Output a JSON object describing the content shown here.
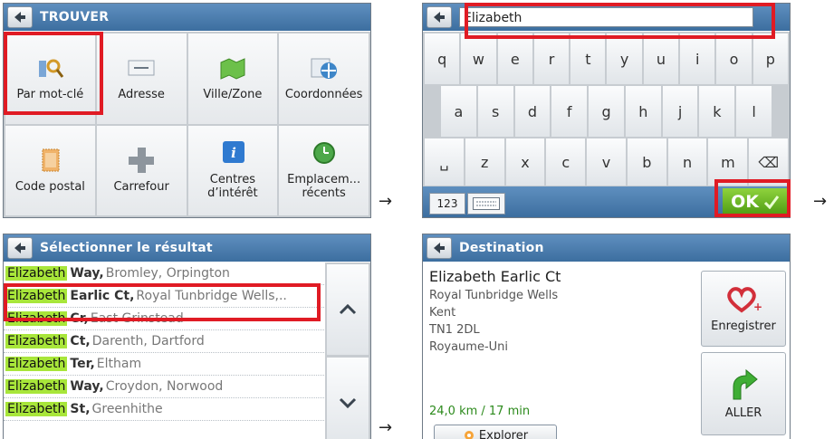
{
  "panels": {
    "trouver": {
      "title": "TROUVER",
      "tiles": [
        {
          "label": "Par mot-clé",
          "icon": "keyword-search-icon"
        },
        {
          "label": "Adresse",
          "icon": "address-card-icon"
        },
        {
          "label": "Ville/Zone",
          "icon": "map-region-icon"
        },
        {
          "label": "Coordonnées",
          "icon": "globe-coordinates-icon"
        },
        {
          "label": "Code postal",
          "icon": "postage-stamp-icon"
        },
        {
          "label": "Carrefour",
          "icon": "crossroads-icon"
        },
        {
          "label": "Centres\nd’intérêt",
          "icon": "info-icon"
        },
        {
          "label": "Emplacem...\nrécents",
          "icon": "recent-clock-icon"
        }
      ]
    },
    "keyboard": {
      "input_value": "Elizabeth",
      "rows": [
        [
          "q",
          "w",
          "e",
          "r",
          "t",
          "y",
          "u",
          "i",
          "o",
          "p"
        ],
        [
          "a",
          "s",
          "d",
          "f",
          "g",
          "h",
          "j",
          "k",
          "l"
        ],
        [
          "␣",
          "z",
          "x",
          "c",
          "v",
          "b",
          "n",
          "m",
          "⌫"
        ]
      ],
      "btn_123": "123",
      "ok_label": "OK"
    },
    "results": {
      "title": "Sélectionner le résultat",
      "rows": [
        {
          "hl": "Elizabeth",
          "main": "Way,",
          "rest": "Bromley, Orpington"
        },
        {
          "hl": "Elizabeth",
          "main": "Earlic Ct,",
          "rest": "Royal Tunbridge Wells,.."
        },
        {
          "hl": "Elizabeth",
          "main": "Cr,",
          "rest": "East Grinstead"
        },
        {
          "hl": "Elizabeth",
          "main": "Ct,",
          "rest": "Darenth, Dartford"
        },
        {
          "hl": "Elizabeth",
          "main": "Ter,",
          "rest": "Eltham"
        },
        {
          "hl": "Elizabeth",
          "main": "Way,",
          "rest": "Croydon, Norwood"
        },
        {
          "hl": "Elizabeth",
          "main": "St,",
          "rest": "Greenhithe"
        }
      ]
    },
    "destination": {
      "title": "Destination",
      "name": "Elizabeth Earlic Ct",
      "line1": "Royal Tunbridge Wells",
      "line2": "Kent",
      "line3": "TN1 2DL",
      "line4": "Royaume-Uni",
      "distance": "24,0 km / 17 min",
      "explore_label": "Explorer",
      "save_label": "Enregistrer",
      "go_label": "ALLER"
    }
  },
  "arrow_glyph": "→",
  "colors": {
    "titlebar": "#4a7fb3",
    "highlight": "#a8e63a",
    "ok_green": "#6bbf23",
    "red_box": "#e01b24"
  }
}
